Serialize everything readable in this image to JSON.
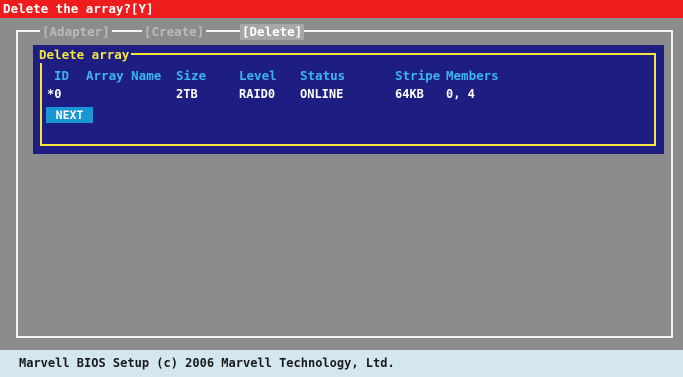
{
  "prompt": {
    "text": "Delete the array?[Y]"
  },
  "tabs": [
    {
      "label": "[Adapter]"
    },
    {
      "label": "[Create]"
    },
    {
      "label": "[Delete]"
    }
  ],
  "dialog": {
    "title": "Delete array",
    "columns": [
      "ID",
      "Array Name",
      "Size",
      "Level",
      "Status",
      "Stripe",
      "Members"
    ],
    "rows": [
      {
        "id": "*0",
        "array_name": "",
        "size": "2TB",
        "level": "RAID0",
        "status": "ONLINE",
        "stripe": "64KB",
        "members": "0, 4"
      }
    ],
    "next_label": "NEXT"
  },
  "footer": {
    "text": "Marvell BIOS Setup (c) 2006 Marvell Technology, Ltd."
  },
  "colors": {
    "background": "#8c8c8c",
    "prompt_bar": "#ee1c1c",
    "dialog_bg": "#1e1e82",
    "dialog_border": "#f2e63c",
    "header_text": "#3cb4ef",
    "button": "#1a96d4",
    "footer_bg": "#d4e6f0"
  }
}
